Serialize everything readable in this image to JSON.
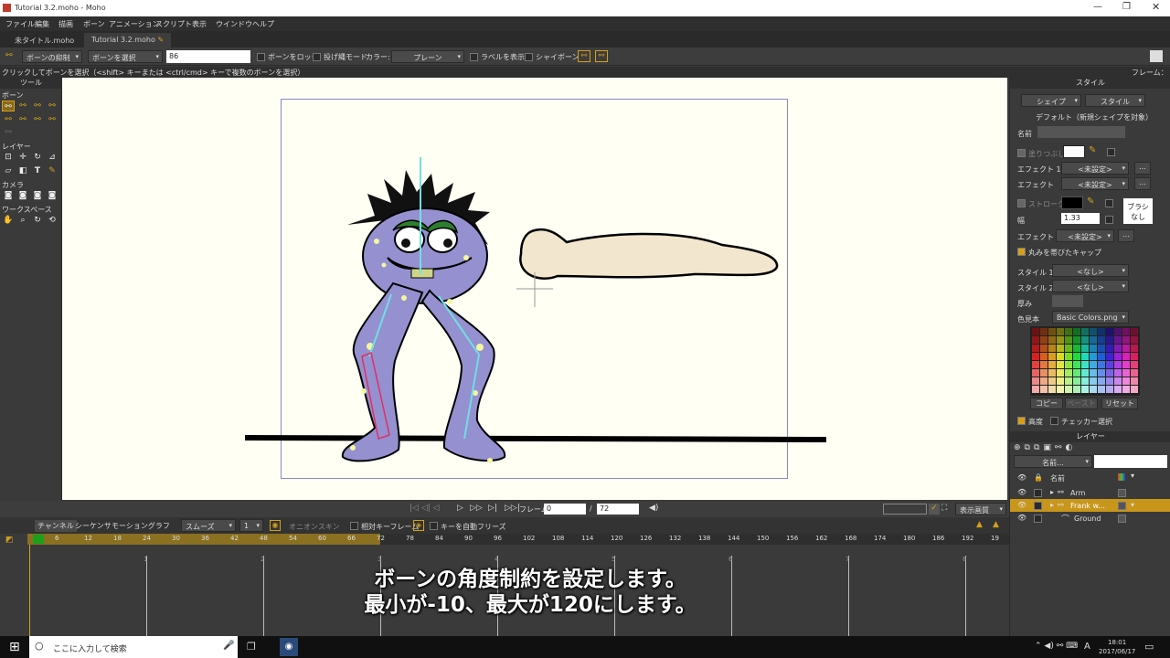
{
  "window": {
    "title": "Tutorial 3.2.moho - Moho"
  },
  "menu": [
    "ファイル",
    "編集",
    "描画",
    "ボーン",
    "アニメーション",
    "スクリプト",
    "表示",
    "ウインドウ",
    "ヘルプ"
  ],
  "tabs": [
    {
      "label": "未タイトル.moho"
    },
    {
      "label": "Tutorial 3.2.moho"
    }
  ],
  "toolopts": {
    "constraint_btn": "ボーンの抑制",
    "select_dd": "ボーンを選択",
    "angle_value": "86",
    "lock_label": "ボーンをロック",
    "ik_label": "投げ縄モード",
    "color_label": "カラー:",
    "color_dd": "プレーン",
    "show_label": "ラベルを表示",
    "shy_label": "シャイボーン"
  },
  "status": {
    "hint": "クリックしてボーンを選択（<shift> キーまたは <ctrl/cmd> キーで複数のボーンを選択）",
    "frame": "フレーム："
  },
  "tools": {
    "title": "ツール",
    "bone": "ボーン",
    "layer": "レイヤー",
    "camera": "カメラ",
    "workspace": "ワークスペース"
  },
  "playbar": {
    "frame_label": "フレーム",
    "frame_value": "0",
    "total": "72",
    "view_label": "表示画質"
  },
  "timeline": {
    "tabs": [
      "チャンネル",
      "シーケンサ",
      "モーショングラフ"
    ],
    "smooth": "スムーズ",
    "step": "1",
    "onion": "オニオンスキン",
    "relative": "相対キーフレーム",
    "auto_freeze": "キーを自動フリーズ",
    "ruler": [
      "6",
      "12",
      "18",
      "24",
      "30",
      "36",
      "42",
      "48",
      "54",
      "60",
      "66",
      "72",
      "78",
      "84",
      "90",
      "96",
      "102",
      "108",
      "114",
      "120",
      "126",
      "132",
      "138",
      "144",
      "150",
      "156",
      "162",
      "168",
      "174",
      "180",
      "186",
      "192",
      "19"
    ],
    "markers": [
      "1",
      "2",
      "3",
      "4",
      "5",
      "6",
      "7",
      "8"
    ]
  },
  "style": {
    "title": "スタイル",
    "shape_dd": "シェイプ",
    "style_dd": "スタイル",
    "default_note": "デフォルト（新規シェイプを対象）",
    "name_label": "名前",
    "fill_label": "塗りつぶし",
    "effect1_label": "エフェクト 1",
    "effect1_value": "<未設定>",
    "effect_label": "エフェクト",
    "effect_value": "<未設定>",
    "stroke_label": "ストローク",
    "brush_btn": "ブラシ なし",
    "width_label": "幅",
    "width_value": "1.33",
    "effect2_label": "エフェクト",
    "effect2_value": "<未設定>",
    "round_cap": "丸みを帯びたキャップ",
    "style1_label": "スタイル 1",
    "style1_value": "<なし>",
    "style2_label": "スタイル 2",
    "style2_value": "<なし>",
    "thickness_label": "厚み",
    "swatch_label": "色見本",
    "swatch_value": "Basic Colors.png",
    "copy_btn": "コピー",
    "paste_btn": "ペースト",
    "reset_btn": "リセット",
    "hq_label": "高度",
    "checker_label": "チェッカー選択"
  },
  "layers": {
    "title": "レイヤー",
    "filter_dd": "名前...",
    "name_col": "名前",
    "items": [
      {
        "name": "Arm"
      },
      {
        "name": "Frank w..."
      },
      {
        "name": "Ground"
      }
    ]
  },
  "subtitle": {
    "line1": "ボーンの角度制約を設定します。",
    "line2": "最小が-10、最大が120にします。"
  },
  "taskbar": {
    "search": "ここに入力して検索",
    "time": "18:01",
    "date": "2017/06/17",
    "ime": "A"
  },
  "colors": {
    "accent": "#d4a017",
    "canvas": "#fffff4",
    "frame_border": "#8888cc",
    "selected_layer": "#c8961a"
  }
}
